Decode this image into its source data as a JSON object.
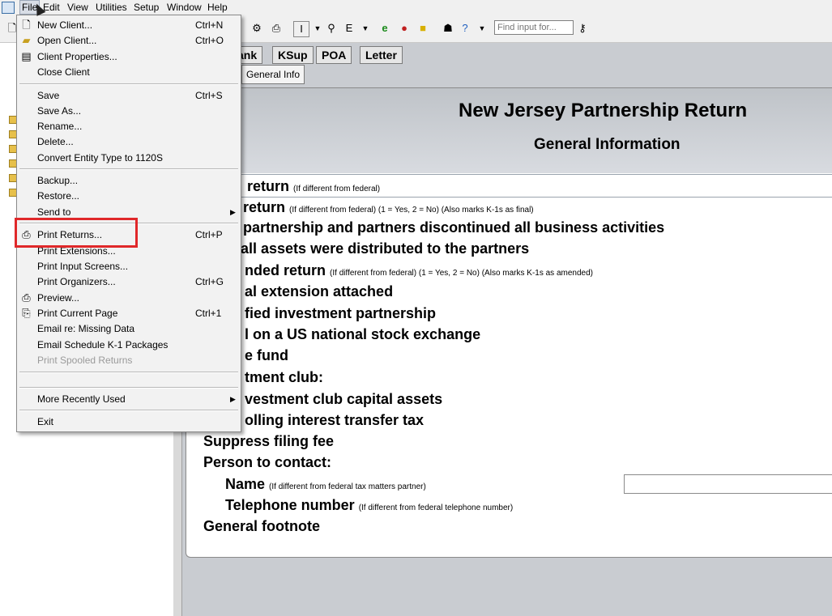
{
  "menubar": {
    "items": [
      "File",
      "Edit",
      "View",
      "Utilities",
      "Setup",
      "Window",
      "Help"
    ]
  },
  "toolbar": {
    "find_placeholder": "Find input for..."
  },
  "tabs": {
    "row1": [
      "ank",
      "KSup",
      "POA",
      "Letter"
    ],
    "row2": [
      "General Info"
    ]
  },
  "form": {
    "title": "New Jersey Partnership Return",
    "subtitle": "General Information",
    "lines": [
      {
        "text": "return",
        "note": "(If different from federal)"
      },
      {
        "text": "return",
        "note": "(If different from federal) (1 = Yes, 2 = No) (Also marks K-1s as final)"
      },
      {
        "text": "partnership and partners discontinued all business activities",
        "note": ""
      },
      {
        "text": "all assets were distributed to the partners",
        "note": ""
      },
      {
        "text": "nded return",
        "note": "(If different from federal) (1 = Yes, 2 = No) (Also marks K-1s as amended)"
      },
      {
        "text": "al extension attached",
        "note": ""
      },
      {
        "text": "fied investment partnership",
        "note": ""
      },
      {
        "text": "l on a US national stock exchange",
        "note": ""
      },
      {
        "text": "e fund",
        "note": ""
      },
      {
        "text": "tment club:",
        "note": ""
      },
      {
        "text": "vestment club capital assets",
        "note": ""
      },
      {
        "text": "olling interest transfer tax",
        "note": ""
      },
      {
        "text": "Suppress filing fee",
        "note": ""
      },
      {
        "text": "Person to contact:",
        "note": ""
      },
      {
        "text": "Name",
        "note": "(If different from federal tax matters partner)"
      },
      {
        "text": "Telephone number",
        "note": "(If different from federal telephone number)"
      },
      {
        "text": "General footnote",
        "note": ""
      }
    ]
  },
  "file_menu": {
    "items": [
      {
        "label": "New Client...",
        "shortcut": "Ctrl+N"
      },
      {
        "label": "Open Client...",
        "shortcut": "Ctrl+O"
      },
      {
        "label": "Client Properties...",
        "shortcut": ""
      },
      {
        "label": "Close Client",
        "shortcut": ""
      },
      {
        "label": "Save",
        "shortcut": "Ctrl+S"
      },
      {
        "label": "Save As...",
        "shortcut": ""
      },
      {
        "label": "Rename...",
        "shortcut": ""
      },
      {
        "label": "Delete...",
        "shortcut": ""
      },
      {
        "label": "Convert Entity Type to 1120S",
        "shortcut": ""
      },
      {
        "label": "Backup...",
        "shortcut": ""
      },
      {
        "label": "Restore...",
        "shortcut": ""
      },
      {
        "label": "Send to",
        "shortcut": ""
      },
      {
        "label": "Print Returns...",
        "shortcut": "Ctrl+P"
      },
      {
        "label": "Print Extensions...",
        "shortcut": ""
      },
      {
        "label": "Print Input Screens...",
        "shortcut": ""
      },
      {
        "label": "Print Organizers...",
        "shortcut": "Ctrl+G"
      },
      {
        "label": "Preview...",
        "shortcut": ""
      },
      {
        "label": "Print Current Page",
        "shortcut": "Ctrl+1"
      },
      {
        "label": "Email re: Missing Data",
        "shortcut": ""
      },
      {
        "label": "Email Schedule K-1 Packages",
        "shortcut": ""
      },
      {
        "label": "Print Spooled Returns",
        "shortcut": ""
      },
      {
        "label": "More Recently Used",
        "shortcut": ""
      },
      {
        "label": "Exit",
        "shortcut": ""
      }
    ]
  }
}
